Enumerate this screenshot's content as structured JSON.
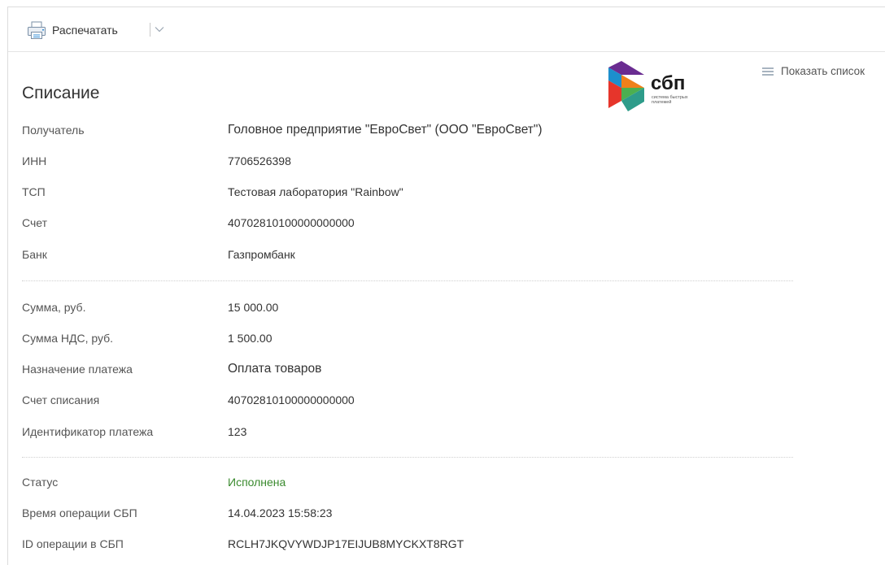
{
  "toolbar": {
    "print_label": "Распечатать",
    "icons": [
      "printer-icon",
      "chevron-down-icon"
    ]
  },
  "header": {
    "title": "Списание",
    "show_list_label": "Показать список",
    "logo": {
      "brand": "сбп",
      "caption_line1": "система быстрых",
      "caption_line2": "платежей",
      "colors": [
        "#1d8fcd",
        "#f0801a",
        "#6a2c91",
        "#4caf50",
        "#e6352b"
      ]
    }
  },
  "section1": [
    {
      "label": "Получатель",
      "value": "Головное предприятие \"ЕвроСвет\" (ООО \"ЕвроСвет\")"
    },
    {
      "label": "ИНН",
      "value": "7706526398"
    },
    {
      "label": "ТСП",
      "value": "Тестовая лаборатория \"Rainbow\""
    },
    {
      "label": "Счет",
      "value": "40702810100000000000"
    },
    {
      "label": "Банк",
      "value": "Газпромбанк"
    }
  ],
  "section2": [
    {
      "label": "Сумма, руб.",
      "value": "15 000.00"
    },
    {
      "label": "Сумма НДС, руб.",
      "value": "1 500.00"
    },
    {
      "label": "Назначение платежа",
      "value": "Оплата товаров"
    },
    {
      "label": "Счет списания",
      "value": "40702810100000000000"
    },
    {
      "label": "Идентификатор платежа",
      "value": "123"
    }
  ],
  "section3": [
    {
      "label": "Статус",
      "value": "Исполнена",
      "color": "#3a8a2e"
    },
    {
      "label": "Время операции СБП",
      "value": "14.04.2023 15:58:23"
    },
    {
      "label": "ID операции в СБП",
      "value": "RCLH7JKQVYWDJP17EIJUB8MYCKXT8RGT"
    }
  ]
}
